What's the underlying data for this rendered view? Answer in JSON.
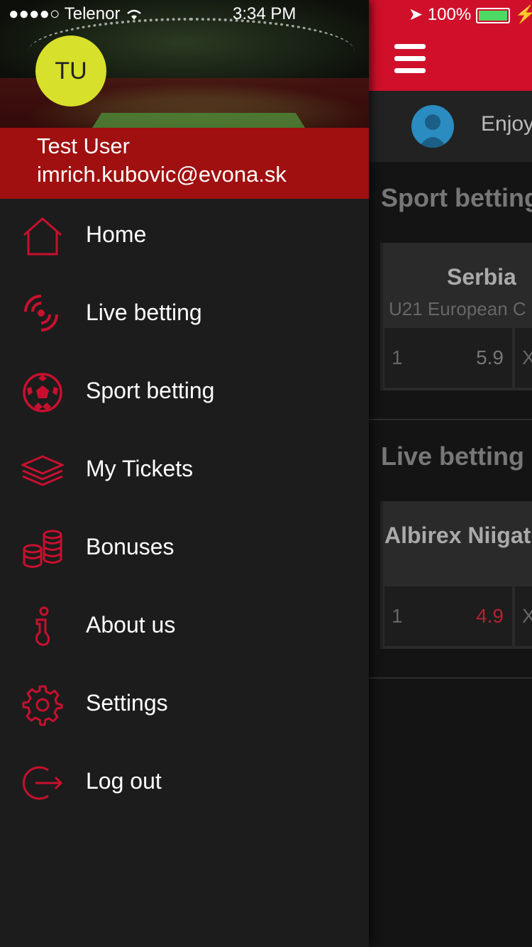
{
  "status": {
    "carrier": "●●●●○ Telenor",
    "time": "3:34 PM",
    "battery": "100%"
  },
  "user": {
    "initials": "TU",
    "name": "Test User",
    "email": "imrich.kubovic@evona.sk"
  },
  "menu": [
    {
      "label": "Home",
      "icon": "home-icon"
    },
    {
      "label": "Live betting",
      "icon": "live-signal-icon"
    },
    {
      "label": "Sport betting",
      "icon": "soccer-ball-icon"
    },
    {
      "label": "My Tickets",
      "icon": "ticket-stack-icon"
    },
    {
      "label": "Bonuses",
      "icon": "coins-icon"
    },
    {
      "label": "About us",
      "icon": "info-icon"
    },
    {
      "label": "Settings",
      "icon": "gear-icon"
    },
    {
      "label": "Log out",
      "icon": "logout-icon"
    }
  ],
  "background": {
    "greeting": "Enjoy",
    "sport_section": {
      "title": "Sport betting",
      "team": "Serbia",
      "league": "U21 European C",
      "odd_key": "1",
      "odd_value": "5.9",
      "odd_next": "X"
    },
    "live_section": {
      "title": "Live betting",
      "team": "Albirex Niigat",
      "odd_key": "1",
      "odd_value": "4.9",
      "odd_next": "X"
    }
  },
  "colors": {
    "accent": "#d0102b",
    "avatar": "#d7e02a",
    "live_odd": "#b3212f"
  }
}
